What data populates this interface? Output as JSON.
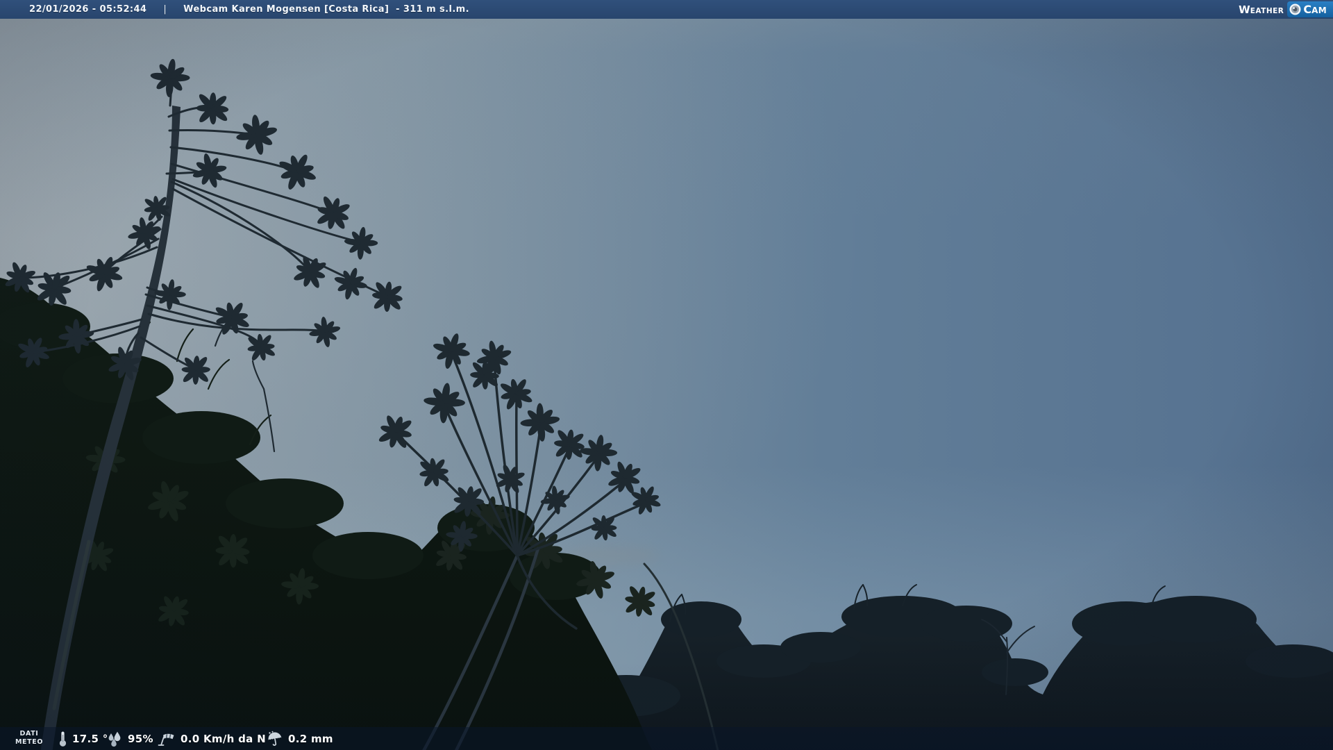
{
  "top_bar": {
    "timestamp": "22/01/2026 - 05:52:44",
    "separator": "|",
    "title": "Webcam Karen Mogensen [Costa Rica]  - 311 m s.l.m."
  },
  "logo": {
    "weather_initial": "W",
    "weather_rest": "EATHER",
    "cam_initial": "C",
    "cam_rest": "AM",
    "lens_icon": "camera-lens-icon"
  },
  "weather_bar": {
    "label_line1": "DATI",
    "label_line2": "METEO",
    "temperature": "17.5 °",
    "humidity": "95%",
    "wind": "0.0 Km/h da N",
    "rain": "0.2 mm",
    "icons": {
      "temperature": "thermometer-icon",
      "humidity": "water-drops-icon",
      "wind": "windsock-icon",
      "rain": "umbrella-rain-icon"
    }
  },
  "colors": {
    "top_bar_bg": "#2b4a73",
    "logo_cam_bg": "#1a6db3",
    "weather_bar_bg": "rgba(9,21,41,0.55)",
    "sky_left": "#93a0aa",
    "sky_right": "#54708f",
    "sky_horizon": "#7e96a6",
    "forest_dark": "#0d1712",
    "tree_silhouette": "#1f2a32"
  }
}
